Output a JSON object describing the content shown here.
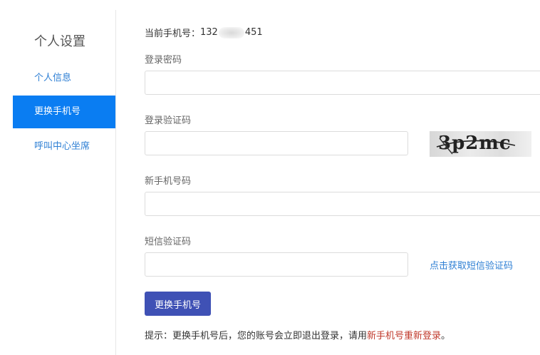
{
  "sidebar": {
    "title": "个人设置",
    "items": [
      {
        "label": "个人信息"
      },
      {
        "label": "更换手机号"
      },
      {
        "label": "呼叫中心坐席"
      }
    ]
  },
  "main": {
    "current_phone_label": "当前手机号：",
    "current_phone_prefix": "132",
    "current_phone_suffix": "451",
    "login_password_label": "登录密码",
    "login_captcha_label": "登录验证码",
    "captcha_text": "3p2mc",
    "new_phone_label": "新手机号码",
    "sms_code_label": "短信验证码",
    "sms_link": "点击获取短信验证码",
    "submit_label": "更换手机号",
    "tip_prefix": "提示：更换手机号后，您的账号会立即退出登录，请用",
    "tip_highlight": "新手机号重新登录",
    "tip_suffix": "。"
  },
  "colors": {
    "active_menu": "#0a7df2",
    "link": "#2e7fd4",
    "button": "#3f51b5",
    "warning_text": "#c0392b"
  }
}
